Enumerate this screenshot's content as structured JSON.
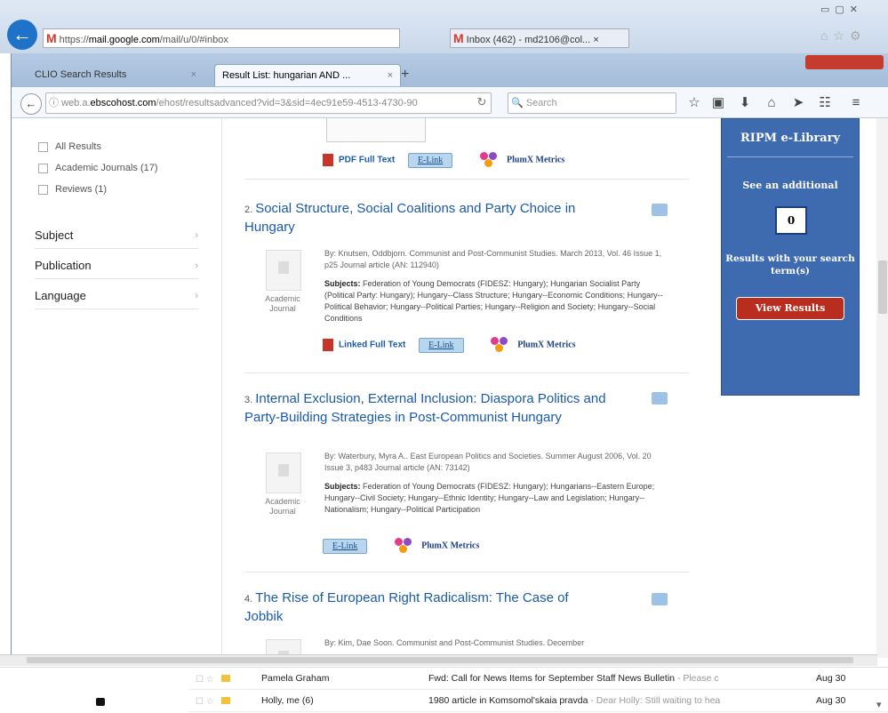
{
  "ie": {
    "url_prefix": "https://",
    "url_host": "mail.google.com",
    "url_rest": "/mail/u/0/#inbox",
    "tab_label": "Inbox (462) - md2106@col...",
    "tab_close": "×"
  },
  "firefox": {
    "tab1": "CLIO Search Results",
    "tab2": "Result List: hungarian AND ...",
    "tab_close": "×",
    "new_tab": "+",
    "url_prefix": "web.a.",
    "url_host": "ebscohost.com",
    "url_rest": "/ehost/resultsadvanced?vid=3&sid=4ec91e59-4513-4730-90",
    "search_placeholder": "Search"
  },
  "left": {
    "checkboxes": [
      {
        "label": "All Results"
      },
      {
        "label": "Academic Journals (17)"
      },
      {
        "label": "Reviews (1)"
      }
    ],
    "facets": [
      "Subject",
      "Publication",
      "Language"
    ]
  },
  "results": [
    {
      "links": {
        "fulltext": "PDF Full Text",
        "elink": "E-Link",
        "plumx": "PlumX Metrics"
      }
    },
    {
      "num": "2.",
      "title": "Social Structure, Social Coalitions and Party Choice in Hungary",
      "type": "Academic Journal",
      "byline": "By: Knutsen, Oddbjorn. Communist and Post-Communist Studies. March 2013, Vol. 46 Issue 1, p25 Journal article (AN: 112940)",
      "subjects_label": "Subjects:",
      "subjects": "Federation of Young Democrats (FIDESZ: Hungary); Hungarian Socialist Party (Political Party: Hungary); Hungary--Class Structure; Hungary--Economic Conditions; Hungary--Political Behavior; Hungary--Political Parties; Hungary--Religion and Society; Hungary--Social Conditions",
      "links": {
        "fulltext": "Linked Full Text",
        "elink": "E-Link",
        "plumx": "PlumX Metrics"
      }
    },
    {
      "num": "3.",
      "title": "Internal Exclusion, External Inclusion: Diaspora Politics and Party-Building Strategies in Post-Communist Hungary",
      "type": "Academic Journal",
      "byline": "By: Waterbury, Myra A.. East European Politics and Societies. Summer August 2006, Vol. 20 Issue 3, p483 Journal article (AN: 73142)",
      "subjects_label": "Subjects:",
      "subjects": "Federation of Young Democrats (FIDESZ: Hungary); Hungarians--Eastern Europe; Hungary--Civil Society; Hungary--Ethnic Identity; Hungary--Law and Legislation; Hungary--Nationalism; Hungary--Political Participation",
      "links": {
        "elink": "E-Link",
        "plumx": "PlumX Metrics"
      }
    },
    {
      "num": "4.",
      "title": "The Rise of European Right Radicalism: The Case of Jobbik",
      "byline": "By: Kim, Dae Soon. Communist and Post-Communist Studies. December"
    }
  ],
  "ripm": {
    "heading": "RIPM e-Library",
    "see_additional": "See an additional",
    "count": "0",
    "results_with": "Results with your search term(s)",
    "button": "View Results"
  },
  "gmail": {
    "rows": [
      {
        "sender": "Pamela Graham",
        "subject": "Fwd: Call for News Items for September Staff News Bulletin",
        "snippet": " - Please c",
        "date": "Aug 30"
      },
      {
        "sender": "Holly, me (6)",
        "subject": "1980 article in Komsomol'skaia pravda",
        "snippet": " - Dear Holly: Still waiting to hea",
        "date": "Aug 30"
      }
    ]
  }
}
